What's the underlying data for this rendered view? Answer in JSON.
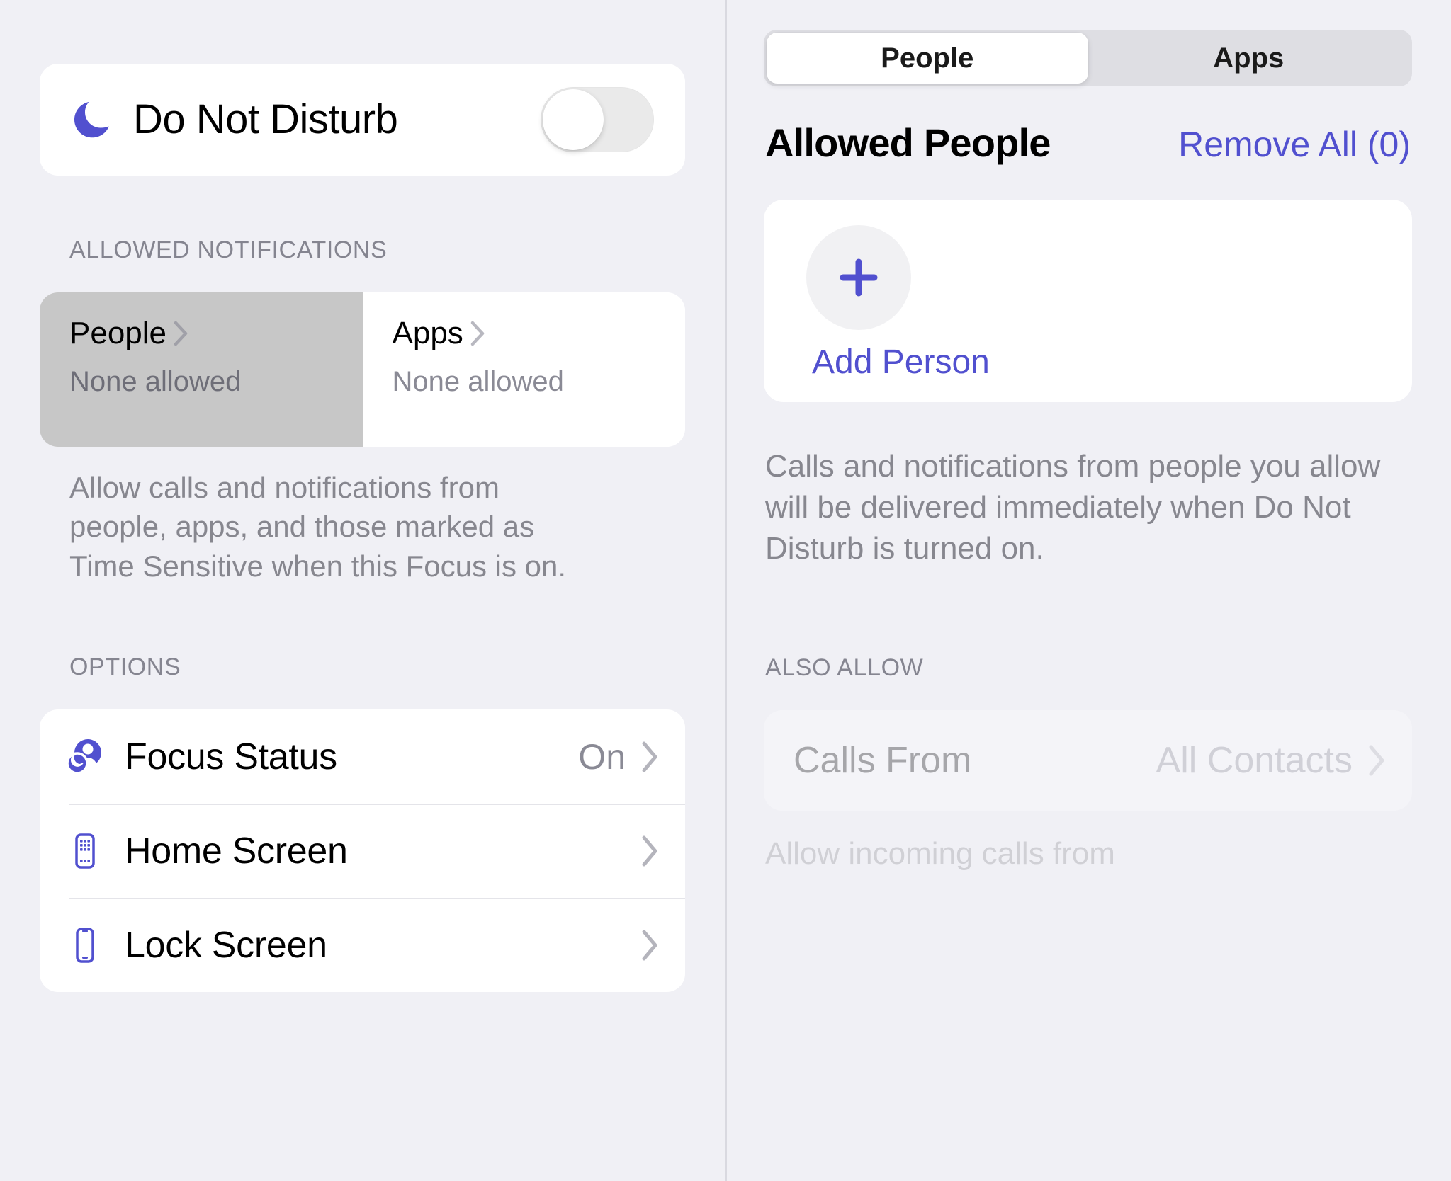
{
  "colors": {
    "accent_purple": "#5150CF",
    "background": "#F0F0F5",
    "card": "#FFFFFF",
    "selected_cell": "#C7C7C7",
    "secondary_text": "#87878F",
    "segment_track": "#DEDEE3"
  },
  "left": {
    "focus": {
      "icon": "moon-icon",
      "title": "Do Not Disturb",
      "toggle_state": "off"
    },
    "allowed_notifications": {
      "header": "ALLOWED NOTIFICATIONS",
      "cells": [
        {
          "title": "People",
          "subtitle": "None allowed",
          "selected": true
        },
        {
          "title": "Apps",
          "subtitle": "None allowed",
          "selected": false
        }
      ],
      "footnote": "Allow calls and notifications from people, apps, and those marked as Time Sensitive when this Focus is on."
    },
    "options": {
      "header": "OPTIONS",
      "rows": [
        {
          "icon": "focus-status-icon",
          "label": "Focus Status",
          "value": "On"
        },
        {
          "icon": "home-screen-icon",
          "label": "Home Screen",
          "value": ""
        },
        {
          "icon": "lock-screen-icon",
          "label": "Lock Screen",
          "value": ""
        }
      ]
    }
  },
  "right": {
    "segmented": {
      "options": [
        "People",
        "Apps"
      ],
      "selected": "People"
    },
    "allowed_people": {
      "title": "Allowed People",
      "remove_all": "Remove All (0)",
      "add_person_label": "Add Person",
      "add_icon": "plus-icon",
      "footnote": "Calls and notifications from people you allow will be delivered immediately when Do Not Disturb is turned on."
    },
    "also_allow": {
      "header": "ALSO ALLOW",
      "calls_from": {
        "label": "Calls From",
        "value": "All Contacts"
      },
      "footnote": "Allow incoming calls from"
    }
  }
}
